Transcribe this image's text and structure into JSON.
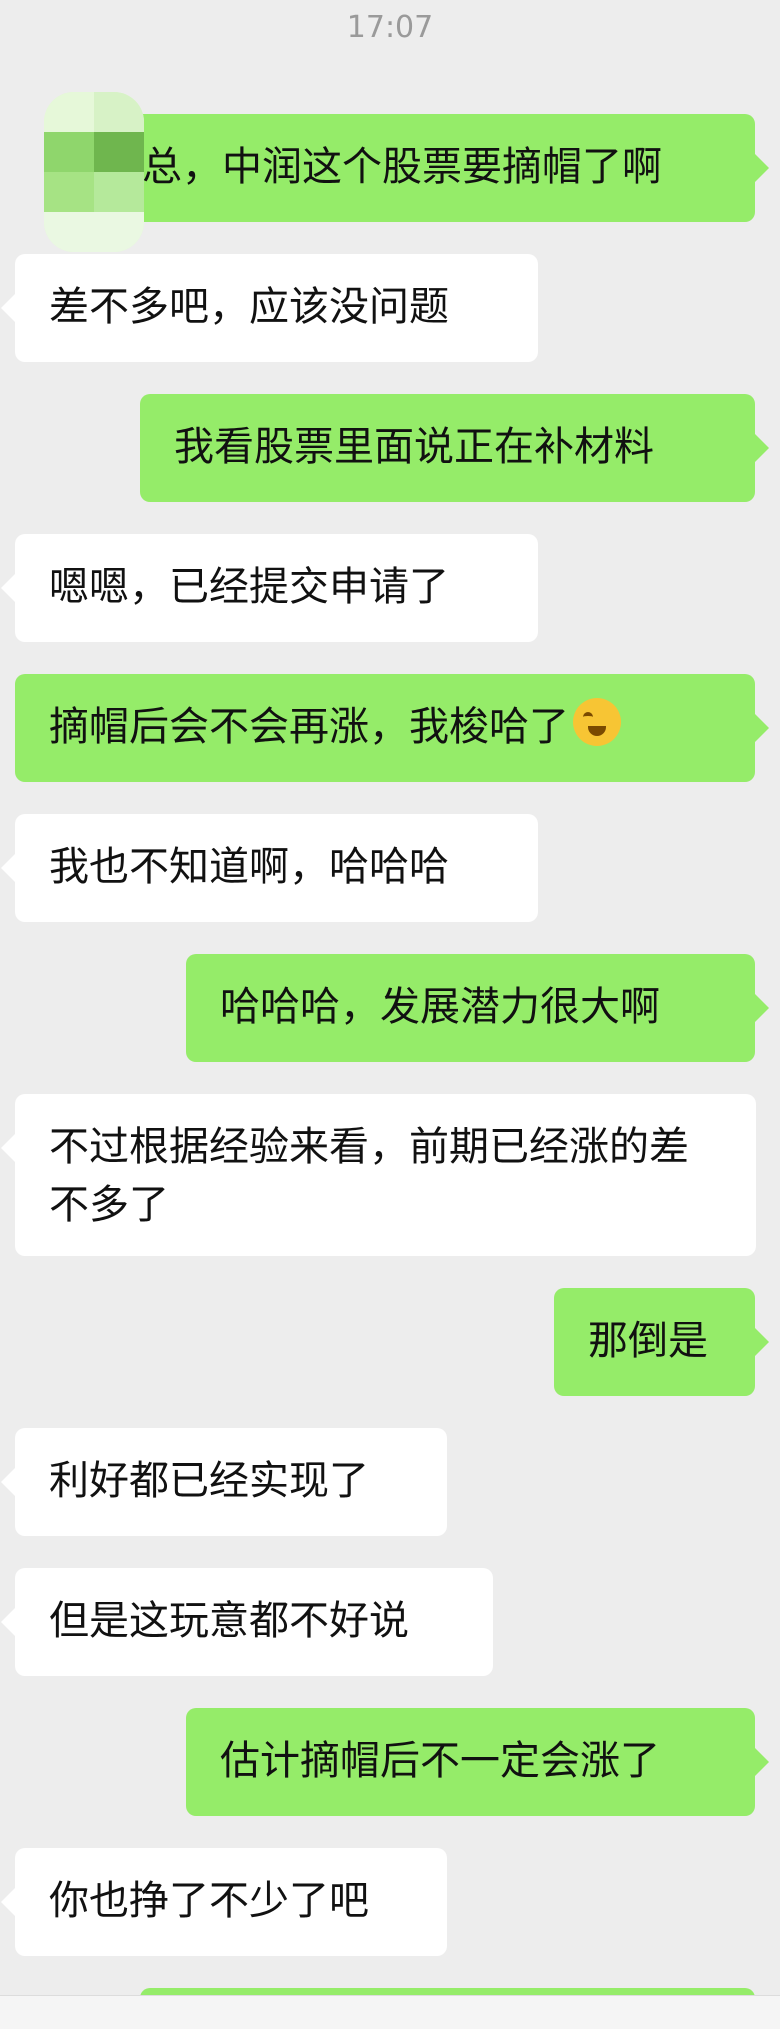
{
  "status": {
    "time": "17:07"
  },
  "colors": {
    "background": "#ededed",
    "incoming": "#ffffff",
    "outgoing": "#95ec69"
  },
  "messages": [
    {
      "side": "out",
      "text": "总，中润这个股票要摘帽了啊"
    },
    {
      "side": "in",
      "text": "差不多吧，应该没问题"
    },
    {
      "side": "out",
      "text": "我看股票里面说正在补材料"
    },
    {
      "side": "in",
      "text": "嗯嗯，已经提交申请了"
    },
    {
      "side": "out",
      "text": "摘帽后会不会再涨，我梭哈了",
      "emoji": "laughing-crying-emoji"
    },
    {
      "side": "in",
      "text": "我也不知道啊，哈哈哈"
    },
    {
      "side": "out",
      "text": "哈哈哈，发展潜力很大啊"
    },
    {
      "side": "in",
      "text": "不过根据经验来看，前期已经涨的差不多了"
    },
    {
      "side": "out",
      "text": "那倒是"
    },
    {
      "side": "in",
      "text": "利好都已经实现了"
    },
    {
      "side": "in",
      "text": "但是这玩意都不好说"
    },
    {
      "side": "out",
      "text": "估计摘帽后不一定会涨了"
    },
    {
      "side": "in",
      "text": "你也挣了不少了吧"
    }
  ]
}
